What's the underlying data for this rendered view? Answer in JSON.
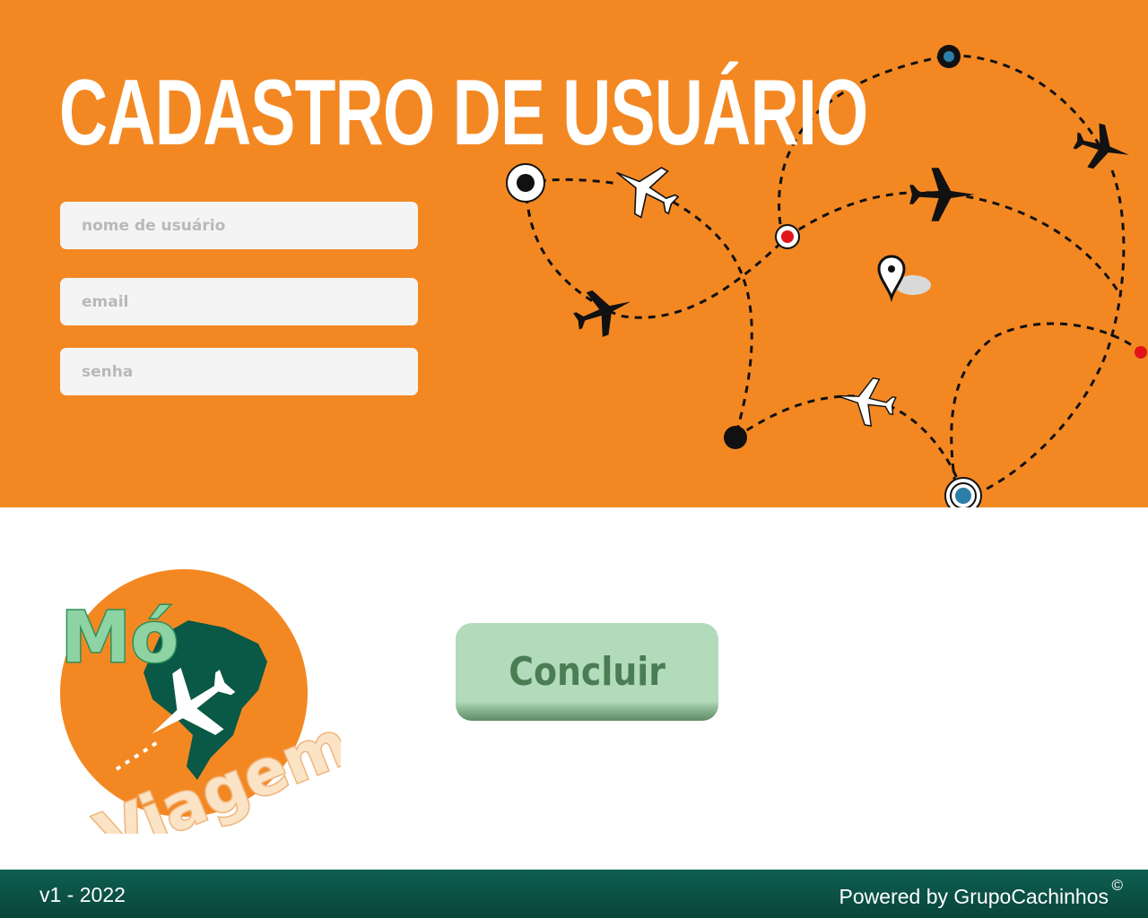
{
  "header": {
    "title": "CADASTRO DE USUÁRIO"
  },
  "form": {
    "username": {
      "placeholder": "nome de usuário",
      "value": ""
    },
    "email": {
      "placeholder": "email",
      "value": ""
    },
    "password": {
      "placeholder": "senha",
      "value": ""
    }
  },
  "logo": {
    "word_top": "Mó",
    "word_bottom": "Viagem"
  },
  "actions": {
    "submit_label": "Concluir"
  },
  "footer": {
    "version": "v1 - 2022",
    "powered": "Powered by GrupoCachinhos",
    "copyright": "©"
  },
  "colors": {
    "hero_background": "#f38823",
    "field_background": "#f4f4f4",
    "button_background": "#b1dbba",
    "button_text": "#4b7d55",
    "footer_background": "#0b5146",
    "logo_green": "#0a5846"
  },
  "icons": [
    "airplane-icon",
    "location-pin-icon",
    "route-dot-icon",
    "logo-airplane-icon"
  ]
}
